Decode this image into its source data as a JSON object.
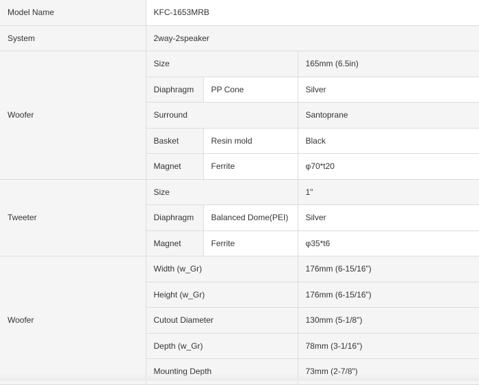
{
  "spec": {
    "model_name": {
      "label": "Model Name",
      "value": "KFC-1653MRB"
    },
    "system": {
      "label": "System",
      "value": "2way-2speaker"
    },
    "woofer": {
      "label": "Woofer",
      "size": {
        "label": "Size",
        "value": "165mm (6.5in)"
      },
      "diaphragm": {
        "label": "Diaphragm",
        "sub": "PP Cone",
        "value": "Silver"
      },
      "surround": {
        "label": "Surround",
        "value": "Santoprane"
      },
      "basket": {
        "label": "Basket",
        "sub": "Resin mold",
        "value": "Black"
      },
      "magnet": {
        "label": "Magnet",
        "sub": "Ferrite",
        "value": "φ70*t20"
      }
    },
    "tweeter": {
      "label": "Tweeter",
      "size": {
        "label": "Size",
        "value": "1\""
      },
      "diaphragm": {
        "label": "Diaphragm",
        "sub": "Balanced Dome(PEI)",
        "value": "Silver"
      },
      "magnet": {
        "label": "Magnet",
        "sub": "Ferrite",
        "value": "φ35*t6"
      }
    },
    "woofer_dimensions": {
      "label": "Woofer",
      "width": {
        "label": "Width (w_Gr)",
        "value": "176mm (6-15/16\")"
      },
      "height": {
        "label": "Height (w_Gr)",
        "value": "176mm (6-15/16\")"
      },
      "cutout": {
        "label": "Cutout Diameter",
        "value": "130mm (5-1/8\")"
      },
      "depth": {
        "label": "Depth (w_Gr)",
        "value": "78mm (3-1/16\")"
      },
      "mounting_depth": {
        "label": "Mounting Depth",
        "value": "73mm (2-7/8\")"
      }
    }
  }
}
